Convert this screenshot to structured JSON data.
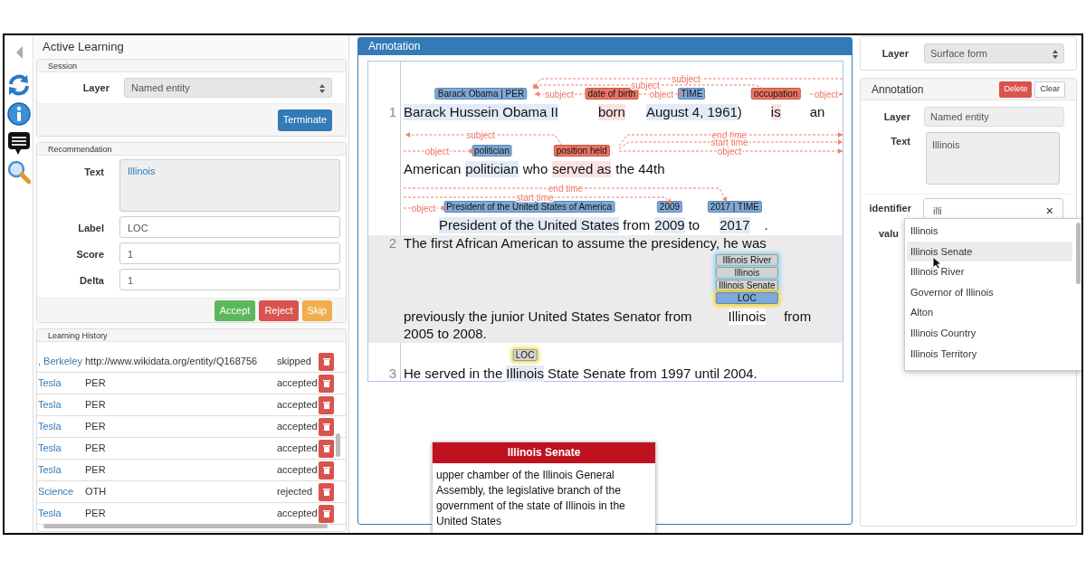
{
  "active_learning": {
    "title": "Active Learning",
    "session": {
      "heading": "Session",
      "layer_label": "Layer",
      "layer_value": "Named entity",
      "button": "Terminate"
    },
    "recommendation": {
      "heading": "Recommendation",
      "fields": [
        {
          "label": "Text",
          "value": "Illinois",
          "kind": "textarea"
        },
        {
          "label": "Label",
          "value": "LOC",
          "kind": "input"
        },
        {
          "label": "Score",
          "value": "1",
          "kind": "input"
        },
        {
          "label": "Delta",
          "value": "1",
          "kind": "input"
        }
      ],
      "buttons": [
        {
          "label": "Accept",
          "kind": "success"
        },
        {
          "label": "Reject",
          "kind": "danger"
        },
        {
          "label": "Skip",
          "kind": "warning"
        }
      ]
    },
    "history": {
      "heading": "Learning History",
      "rows": [
        {
          "text": ", Berkeley",
          "label": "http://www.wikidata.org/entity/Q168756",
          "status": "skipped"
        },
        {
          "text": "Tesla",
          "label": "PER",
          "status": "accepted"
        },
        {
          "text": "Tesla",
          "label": "PER",
          "status": "accepted"
        },
        {
          "text": "Tesla",
          "label": "PER",
          "status": "accepted"
        },
        {
          "text": "Tesla",
          "label": "PER",
          "status": "accepted"
        },
        {
          "text": "Tesla",
          "label": "PER",
          "status": "accepted"
        },
        {
          "text": "Science",
          "label": "OTH",
          "status": "rejected"
        },
        {
          "text": "Tesla",
          "label": "PER",
          "status": "accepted"
        }
      ]
    }
  },
  "annotation": {
    "title": "Annotation",
    "sentences": [
      {
        "number": "1",
        "selected": false,
        "lines": [
          {
            "tokens": [
              {
                "text": "Barack Hussein Obama II",
                "kind": "entity",
                "labels": [
                  {
                    "text": "Barack Obama | PER",
                    "kind": "entity"
                  }
                ]
              },
              {
                "text": "born",
                "kind": "relation",
                "labels": [
                  {
                    "text": "date of birth",
                    "kind": "relation"
                  }
                ]
              },
              {
                "text": "August 4, 1961",
                "kind": "entity",
                "labels": [
                  {
                    "text": "TIME",
                    "kind": "entity"
                  }
                ]
              },
              {
                "text": ")",
                "kind": "plain"
              },
              {
                "text": "is",
                "kind": "relation",
                "labels": [
                  {
                    "text": "occupation",
                    "kind": "relation"
                  }
                ]
              },
              {
                "text": "an",
                "kind": "plain"
              }
            ],
            "arcs": [
              {
                "label": "subject"
              },
              {
                "label": "subject"
              },
              {
                "label": "subject"
              },
              {
                "label": "object"
              },
              {
                "label": "object"
              }
            ]
          },
          {
            "tokens": [
              {
                "text": "American",
                "kind": "plain"
              },
              {
                "text": "politician",
                "kind": "entity",
                "labels": [
                  {
                    "text": "politician",
                    "kind": "entity"
                  }
                ]
              },
              {
                "text": "who",
                "kind": "plain"
              },
              {
                "text": "served as",
                "kind": "relation",
                "labels": [
                  {
                    "text": "position held",
                    "kind": "relation"
                  }
                ]
              },
              {
                "text": "the 44th",
                "kind": "plain"
              }
            ],
            "arcs": [
              {
                "label": "subject"
              },
              {
                "label": "object"
              },
              {
                "label": "end time"
              },
              {
                "label": "start time"
              },
              {
                "label": "object"
              }
            ]
          },
          {
            "tokens": [
              {
                "text": "President of the United States",
                "kind": "entity",
                "labels": [
                  {
                    "text": "President of the United States of America",
                    "kind": "entity"
                  }
                ]
              },
              {
                "text": "from",
                "kind": "plain"
              },
              {
                "text": "2009",
                "kind": "entity",
                "labels": [
                  {
                    "text": "2009",
                    "kind": "entity"
                  }
                ]
              },
              {
                "text": "to",
                "kind": "plain"
              },
              {
                "text": "2017",
                "kind": "entity",
                "labels": [
                  {
                    "text": "2017 | TIME",
                    "kind": "entity"
                  }
                ]
              },
              {
                "text": ".",
                "kind": "plain"
              }
            ],
            "arcs": [
              {
                "label": "end time"
              },
              {
                "label": "start time"
              },
              {
                "label": "object"
              }
            ]
          }
        ]
      },
      {
        "number": "2",
        "selected": true,
        "lines": [
          {
            "tokens": [
              {
                "text": "The first African American to assume the presidency, he was",
                "kind": "plain"
              }
            ]
          },
          {
            "tokens": [
              {
                "text": "previously the junior United States Senator from",
                "kind": "plain"
              },
              {
                "text": "Illinois",
                "kind": "focus",
                "labels": [
                  {
                    "text": "Illinois River",
                    "kind": "candidate"
                  },
                  {
                    "text": "Illinois",
                    "kind": "candidate"
                  },
                  {
                    "text": "Illinois Senate",
                    "kind": "candidate"
                  },
                  {
                    "text": "LOC",
                    "kind": "selected"
                  }
                ]
              },
              {
                "text": "from",
                "kind": "plain"
              }
            ]
          },
          {
            "tokens": [
              {
                "text": "2005 to 2008.",
                "kind": "plain"
              }
            ]
          }
        ]
      },
      {
        "number": "3",
        "selected": false,
        "lines": [
          {
            "tokens": [
              {
                "text": "He served in the",
                "kind": "plain"
              },
              {
                "text": "Illinois",
                "kind": "entity",
                "labels": [
                  {
                    "text": "LOC",
                    "kind": "recommended"
                  }
                ]
              },
              {
                "text": "State Senate from 1997 until 2004.",
                "kind": "plain"
              }
            ]
          }
        ]
      }
    ]
  },
  "tooltip": {
    "title": "Illinois Senate",
    "description": "upper chamber of the Illinois General Assembly, the legislative branch of the government of the state of Illinois in the United States"
  },
  "right_panel": {
    "layer_label": "Layer",
    "layer_value": "Surface form",
    "editor": {
      "title": "Annotation",
      "buttons": [
        {
          "label": "Delete",
          "kind": "danger"
        },
        {
          "label": "Clear",
          "kind": "default"
        }
      ],
      "layer": {
        "label": "Layer",
        "value": "Named entity"
      },
      "text": {
        "label": "Text",
        "value": "Illinois"
      },
      "identifier": {
        "label": "identifier",
        "value": "illi",
        "clear": "×"
      },
      "value_label": "valu",
      "suggestions": [
        {
          "text": "Illinois",
          "selected": false
        },
        {
          "text": "Illinois Senate",
          "selected": true
        },
        {
          "text": "Illinois River",
          "selected": false
        },
        {
          "text": "Governor of Illinois",
          "selected": false
        },
        {
          "text": "Alton",
          "selected": false
        },
        {
          "text": "Illinois Country",
          "selected": false
        },
        {
          "text": "Illinois Territory",
          "selected": false
        }
      ]
    }
  }
}
